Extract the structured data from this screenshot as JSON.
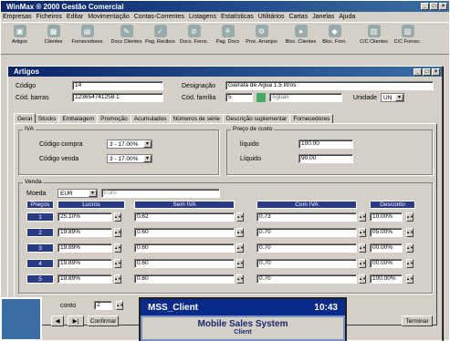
{
  "app": {
    "title": "WinMax ® 2000 Gestão Comercial"
  },
  "menu": [
    "Empresas",
    "Ficheiros",
    "Editar",
    "Movimentação",
    "Contas-Correntes",
    "Listagens",
    "Estatísticas",
    "Utilitários",
    "Cartas",
    "Janelas",
    "Ajuda"
  ],
  "toolbar": [
    "Artigos",
    "Clientes",
    "Fornecedores",
    "Docs Clientes",
    "Pag. Recibos",
    "Docs. Forns.",
    "Pag. Docs",
    "Proc. Arranjos",
    "Bloc. Clientes",
    "Bloc. Forn.",
    "C/C Clientes",
    "C/C Fornec."
  ],
  "artigos": {
    "title": "Artigos",
    "codigo_label": "Código",
    "codigo": "14",
    "designacao_label": "Designação",
    "designacao": "Garrafa de Água 1.5 litros",
    "codbarras_label": "Cód. barras",
    "codbarras": "123654741258 1",
    "codfamilia_label": "Cód. família",
    "codfamilia": "5",
    "familia_name": "Águas",
    "unidade_label": "Unidade",
    "unidade": "UN",
    "tabs": [
      "Geral",
      "Stocks",
      "Embalagem",
      "Promoção",
      "Acumulados",
      "Números de série",
      "Descrição suplementar",
      "Fornecedores"
    ],
    "iva": {
      "label": "IVA",
      "compra_label": "Código compra",
      "compra": "3 - 17.00%",
      "venda_label": "Código venda",
      "venda": "3 - 17.00%"
    },
    "custo": {
      "label": "Preço de custo",
      "liquido_label": "líquido",
      "liquido": "100.00",
      "liquido2_label": "Líquido",
      "liquido2": "90.00"
    },
    "venda": {
      "label": "Venda",
      "moeda_label": "Moeda",
      "moeda": "EUR",
      "moeda_name": "Euro",
      "headers": [
        "Preços",
        "Lucros",
        "Sem IVA",
        "Com IVA",
        "Desconto"
      ],
      "rows": [
        {
          "n": "1",
          "lucro": "25.10%",
          "sem": "0.62",
          "com": "0.73",
          "desc": "10.00%"
        },
        {
          "n": "2",
          "lucro": "19.89%",
          "sem": "0.60",
          "com": "0.70",
          "desc": "05.00%"
        },
        {
          "n": "3",
          "lucro": "19.89%",
          "sem": "0.60",
          "com": "0.70",
          "desc": "00.00%"
        },
        {
          "n": "4",
          "lucro": "19.89%",
          "sem": "0.60",
          "com": "0.70",
          "desc": "00.00%"
        },
        {
          "n": "5",
          "lucro": "19.89%",
          "sem": "0.60",
          "com": "0.70",
          "desc": "100.00%"
        }
      ]
    },
    "bottom": {
      "arred_label": "conto",
      "arred": "2",
      "confirmar": "Confirmar",
      "terminar": "Terminar"
    }
  },
  "phone": {
    "title": "MSS_Client",
    "time": "10:43",
    "line1": "Mobile Sales System",
    "line2": "Client"
  }
}
